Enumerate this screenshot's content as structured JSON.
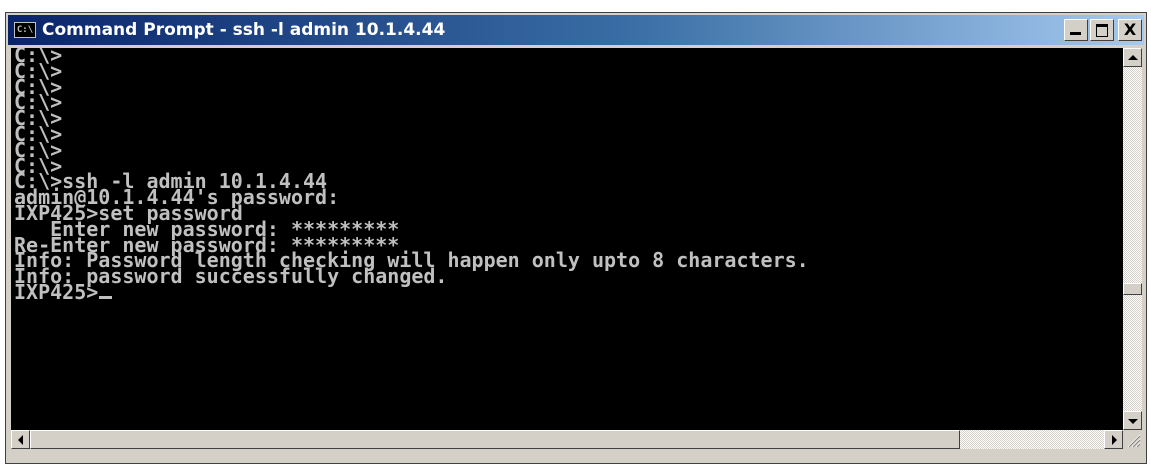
{
  "window": {
    "title": "Command Prompt - ssh -l admin 10.1.4.44",
    "icon_label": "C:\\",
    "close_glyph": "X"
  },
  "console": {
    "lines": [
      "C:\\>",
      "C:\\>",
      "C:\\>",
      "C:\\>",
      "C:\\>",
      "C:\\>",
      "C:\\>",
      "C:\\>",
      "C:\\>ssh -l admin 10.1.4.44",
      "admin@10.1.4.44's password:",
      "IXP425>set password",
      "   Enter new password: *********",
      "Re-Enter new password: *********",
      "Info: Password length checking will happen only upto 8 characters.",
      "Info: password successfully changed.",
      "IXP425>"
    ],
    "text_color": "#c0c0c0",
    "background": "#000000"
  },
  "icons": {
    "app": "console-icon",
    "minimize": "minimize-icon",
    "maximize": "maximize-icon",
    "close": "close-icon",
    "scroll_up": "arrow-up-icon",
    "scroll_down": "arrow-down-icon",
    "scroll_left": "arrow-left-icon",
    "scroll_right": "arrow-right-icon",
    "grip": "resize-grip-icon"
  }
}
